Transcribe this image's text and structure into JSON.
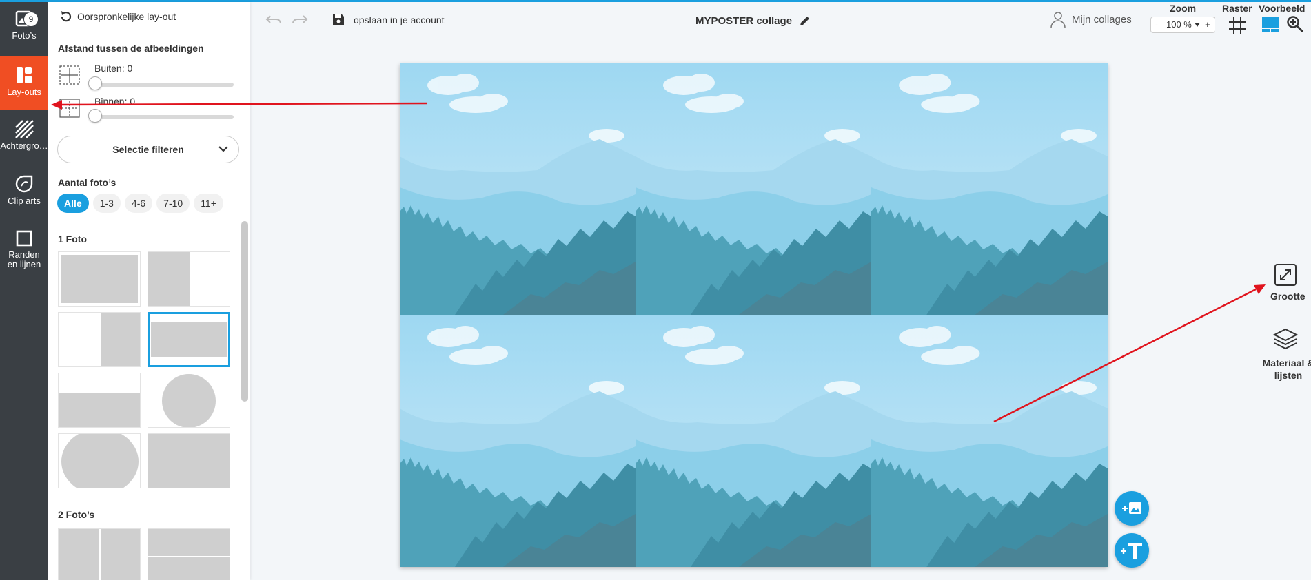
{
  "sidebar": {
    "items": [
      {
        "label": "Foto’s",
        "badge": "9"
      },
      {
        "label": "Lay-outs"
      },
      {
        "label": "Achtergro…"
      },
      {
        "label": "Clip arts"
      },
      {
        "label": "Randen en lijnen"
      }
    ]
  },
  "panel": {
    "reset_label": "Oorspronkelijke lay-out",
    "spacing_title": "Afstand tussen de afbeeldingen",
    "outer_label": "Buiten: 0",
    "inner_label": "Binnen: 0",
    "outer_value": 0,
    "inner_value": 0,
    "filter_label": "Selectie filteren",
    "count_title": "Aantal foto’s",
    "chips": [
      "Alle",
      "1-3",
      "4-6",
      "7-10",
      "11+"
    ],
    "group_one": "1 Foto",
    "group_two": "2 Foto’s"
  },
  "toolbar": {
    "save_label": "opslaan in je account",
    "title": "MYPOSTER collage",
    "my_collages": "Mijn collages",
    "zoom_label": "Zoom",
    "zoom_value": "100 %",
    "zoom_minus": "-",
    "zoom_plus": "+",
    "grid_label": "Raster",
    "preview_label": "Voorbeeld"
  },
  "right": {
    "size_label": "Grootte",
    "material_label": "Materiaal & lijsten"
  },
  "colors": {
    "accent": "#1a9fdf",
    "active_tab": "#f04e23",
    "rail": "#3a3f44",
    "annotation": "#e0141e"
  }
}
